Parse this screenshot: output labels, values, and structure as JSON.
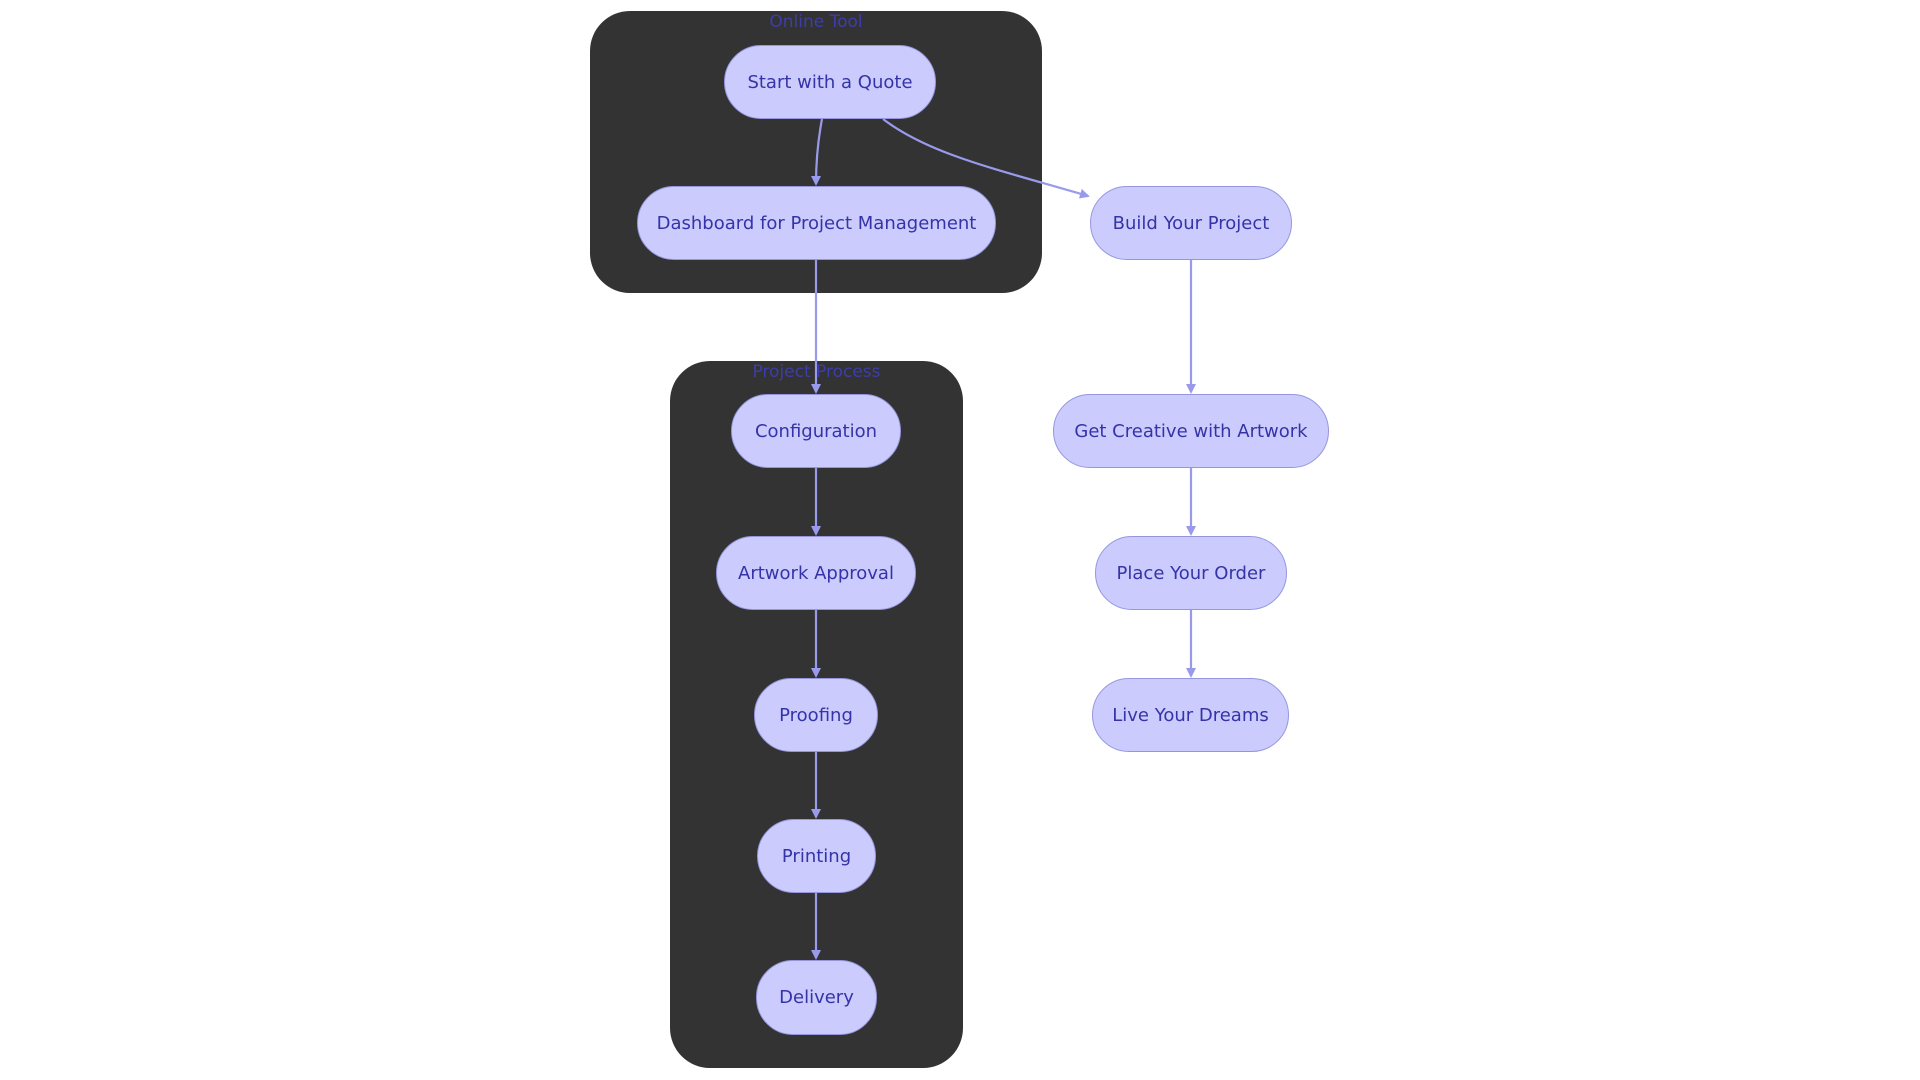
{
  "colors": {
    "cluster_bg": "#333333",
    "node_fill": "#CBCBFD",
    "node_border": "#9696DF",
    "text": "#3434A8",
    "edge": "#9A9AEC",
    "cluster_title": "#3F3FBF"
  },
  "clusters": [
    {
      "id": "online-tool",
      "title": "Online Tool"
    },
    {
      "id": "project-process",
      "title": "Project Process"
    }
  ],
  "nodes": {
    "start_quote": "Start with a Quote",
    "dashboard": "Dashboard for Project Management",
    "build_project": "Build Your Project",
    "configuration": "Configuration",
    "artwork_approval": "Artwork Approval",
    "proofing": "Proofing",
    "printing": "Printing",
    "delivery": "Delivery",
    "get_creative": "Get Creative with Artwork",
    "place_order": "Place Your Order",
    "live_dreams": "Live Your Dreams"
  },
  "edges": [
    {
      "from": "Start with a Quote",
      "to": "Dashboard for Project Management"
    },
    {
      "from": "Start with a Quote",
      "to": "Build Your Project"
    },
    {
      "from": "Dashboard for Project Management",
      "to": "Configuration"
    },
    {
      "from": "Configuration",
      "to": "Artwork Approval"
    },
    {
      "from": "Artwork Approval",
      "to": "Proofing"
    },
    {
      "from": "Proofing",
      "to": "Printing"
    },
    {
      "from": "Printing",
      "to": "Delivery"
    },
    {
      "from": "Build Your Project",
      "to": "Get Creative with Artwork"
    },
    {
      "from": "Get Creative with Artwork",
      "to": "Place Your Order"
    },
    {
      "from": "Place Your Order",
      "to": "Live Your Dreams"
    }
  ]
}
